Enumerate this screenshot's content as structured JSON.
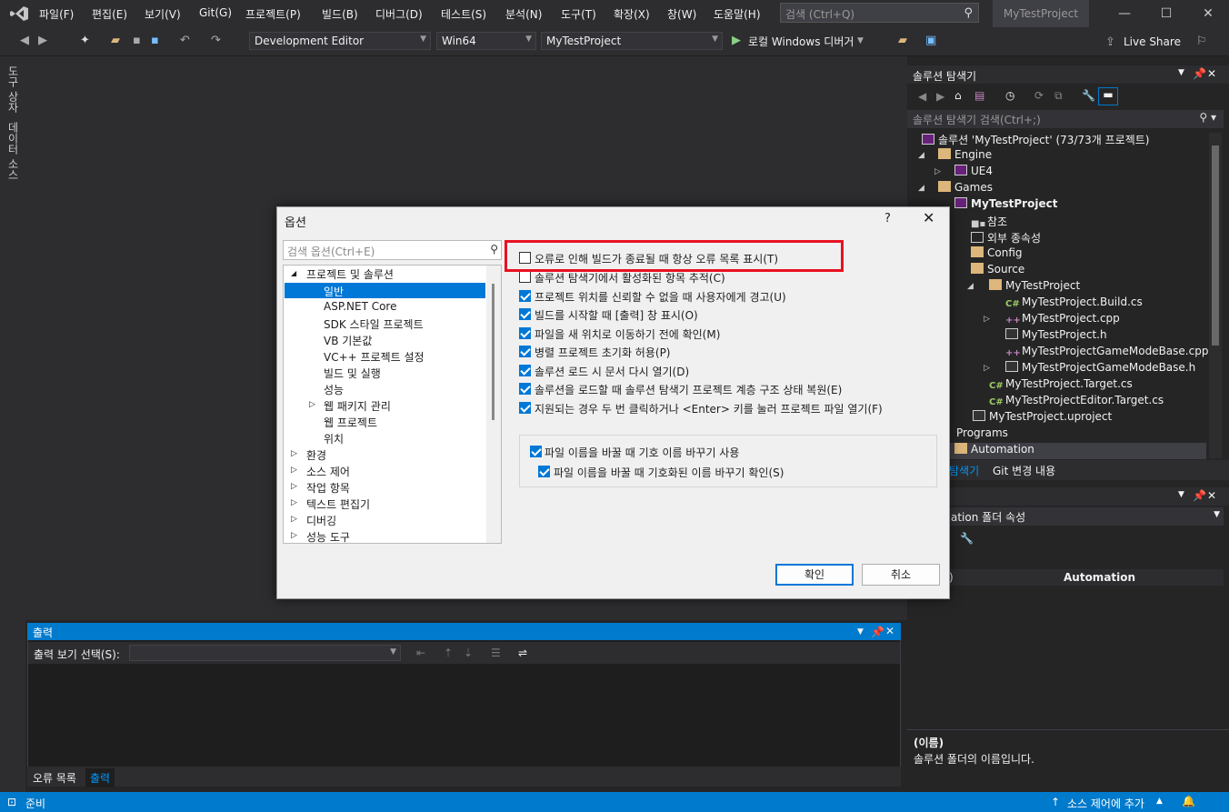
{
  "menubar": {
    "items": [
      "파일(F)",
      "편집(E)",
      "보기(V)",
      "Git(G)",
      "프로젝트(P)",
      "빌드(B)",
      "디버그(D)",
      "테스트(S)",
      "분석(N)",
      "도구(T)",
      "확장(X)",
      "창(W)",
      "도움말(H)"
    ],
    "search_placeholder": "검색 (Ctrl+Q)",
    "project_name": "MyTestProject"
  },
  "toolbar": {
    "config": "Development Editor",
    "platform": "Win64",
    "startup_project": "MyTestProject",
    "run_label": "로컬 Windows 디버거",
    "live_share": "Live Share"
  },
  "left_strip": {
    "tab1": "도구 상자",
    "tab2": "데이터 소스"
  },
  "solution_explorer": {
    "title": "솔루션 탐색기",
    "search_placeholder": "솔루션 탐색기 검색(Ctrl+;)",
    "tree": {
      "solution": "솔루션 'MyTestProject' (73/73개 프로젝트)",
      "engine": "Engine",
      "ue4": "UE4",
      "games": "Games",
      "project": "MyTestProject",
      "references": "참조",
      "external_deps": "외부 종속성",
      "config": "Config",
      "source": "Source",
      "src_folder": "MyTestProject",
      "build_cs": "MyTestProject.Build.cs",
      "cpp": "MyTestProject.cpp",
      "h": "MyTestProject.h",
      "gamemode_cpp": "MyTestProjectGameModeBase.cpp",
      "gamemode_h": "MyTestProjectGameModeBase.h",
      "target_cs": "MyTestProject.Target.cs",
      "editor_target_cs": "MyTestProjectEditor.Target.cs",
      "uproject": "MyTestProject.uproject",
      "programs": "Programs",
      "automation": "Automation"
    },
    "tabs": [
      "탐색기",
      "Git 변경 내용"
    ]
  },
  "properties": {
    "combo": "ation  폴더 속성",
    "grid_key": ")",
    "grid_value": "Automation",
    "desc_title": "(이름)",
    "desc_text": "솔루션 폴더의 이름입니다."
  },
  "output": {
    "title": "출력",
    "source_label": "출력 보기 선택(S):",
    "tabs": [
      "오류 목록",
      "출력"
    ]
  },
  "statusbar": {
    "status": "준비",
    "source_control": "소스 제어에 추가"
  },
  "dialog": {
    "title": "옵션",
    "help": "?",
    "search_placeholder": "검색 옵션(Ctrl+E)",
    "tree": [
      "프로젝트 및 솔루션",
      "일반",
      "ASP.NET Core",
      "SDK 스타일 프로젝트",
      "VB 기본값",
      "VC++ 프로젝트 설정",
      "빌드 및 실행",
      "성능",
      "웹 패키지 관리",
      "웹 프로젝트",
      "위치",
      "환경",
      "소스 제어",
      "작업 항목",
      "텍스트 편집기",
      "디버깅",
      "성능 도구"
    ],
    "options": [
      {
        "label": "오류로 인해 빌드가 종료될 때 항상 오류 목록 표시(T)",
        "checked": false
      },
      {
        "label": "솔루션 탐색기에서 활성화된 항목 추적(C)",
        "checked": false
      },
      {
        "label": "프로젝트 위치를 신뢰할 수 없을 때 사용자에게 경고(U)",
        "checked": true
      },
      {
        "label": "빌드를 시작할 때 [출력] 창 표시(O)",
        "checked": true
      },
      {
        "label": "파일을 새 위치로 이동하기 전에 확인(M)",
        "checked": true
      },
      {
        "label": "병렬 프로젝트 초기화 허용(P)",
        "checked": true
      },
      {
        "label": "솔루션 로드 시 문서 다시 열기(D)",
        "checked": true
      },
      {
        "label": "솔루션을 로드할 때 솔루션 탐색기 프로젝트 계층 구조 상태 복원(E)",
        "checked": true
      },
      {
        "label": "지원되는 경우 두 번 클릭하거나 <Enter> 키를 눌러 프로젝트 파일 열기(F)",
        "checked": true
      }
    ],
    "group_options": [
      {
        "label": "파일 이름을 바꿀 때 기호 이름 바꾸기 사용",
        "checked": true
      },
      {
        "label": "파일 이름을 바꿀 때 기호화된 이름 바꾸기 확인(S)",
        "checked": true
      }
    ],
    "ok": "확인",
    "cancel": "취소"
  },
  "colors": {
    "accent": "#007acc",
    "selection": "#0078d7",
    "highlight_box": "#e81123"
  }
}
